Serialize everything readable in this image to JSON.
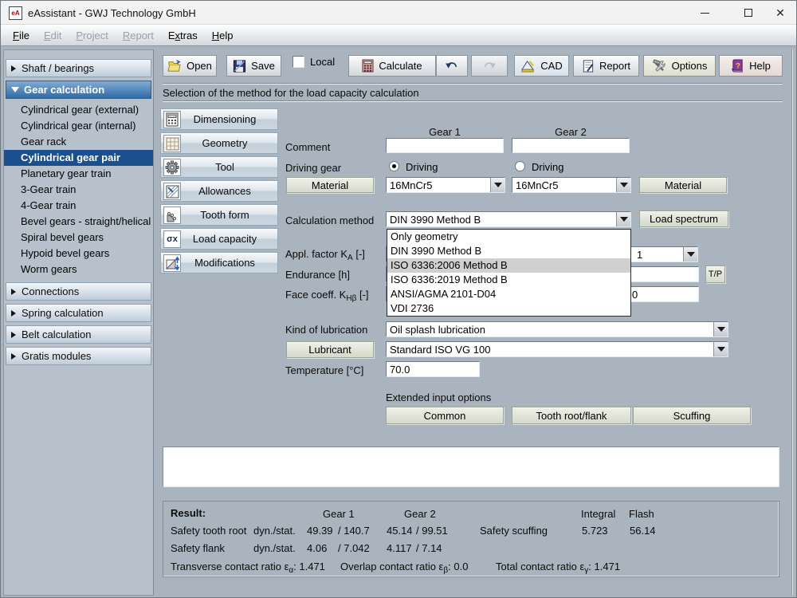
{
  "window": {
    "title": "eAssistant - GWJ Technology GmbH",
    "icon": "eA"
  },
  "menu": {
    "items": [
      {
        "pre": "",
        "key": "F",
        "post": "ile",
        "enabled": true
      },
      {
        "pre": "",
        "key": "E",
        "post": "dit",
        "enabled": false
      },
      {
        "pre": "",
        "key": "P",
        "post": "roject",
        "enabled": false
      },
      {
        "pre": "",
        "key": "R",
        "post": "eport",
        "enabled": false
      },
      {
        "pre": "E",
        "key": "x",
        "post": "tras",
        "enabled": true
      },
      {
        "pre": "",
        "key": "H",
        "post": "elp",
        "enabled": true
      }
    ]
  },
  "toolbar": {
    "open": "Open",
    "save": "Save",
    "local": "Local",
    "local_checked": false,
    "calculate": "Calculate",
    "cad": "CAD",
    "report": "Report",
    "options": "Options",
    "help": "Help"
  },
  "sidebar": {
    "sections": [
      {
        "label": "Shaft / bearings",
        "expanded": false
      },
      {
        "label": "Gear calculation",
        "expanded": true
      },
      {
        "label": "Connections",
        "expanded": false
      },
      {
        "label": "Spring calculation",
        "expanded": false
      },
      {
        "label": "Belt calculation",
        "expanded": false
      },
      {
        "label": "Gratis modules",
        "expanded": false
      }
    ],
    "gear_items": [
      "Cylindrical gear (external)",
      "Cylindrical gear (internal)",
      "Gear rack",
      "Cylindrical gear pair",
      "Planetary gear train",
      "3-Gear train",
      "4-Gear train",
      "Bevel gears - straight/helical",
      "Spiral bevel gears",
      "Hypoid bevel gears",
      "Worm gears"
    ],
    "selected": "Cylindrical gear pair"
  },
  "content": {
    "heading": "Selection of the method for the load capacity calculation",
    "nav_buttons": [
      {
        "label": "Dimensioning"
      },
      {
        "label": "Geometry"
      },
      {
        "label": "Tool"
      },
      {
        "label": "Allowances"
      },
      {
        "label": "Tooth form"
      },
      {
        "label": "Load capacity"
      },
      {
        "label": "Modifications"
      }
    ],
    "sigma_glyph": "σx",
    "form": {
      "gear1_header": "Gear 1",
      "gear2_header": "Gear 2",
      "comment_label": "Comment",
      "comment_gear1": "",
      "comment_gear2": "",
      "driving_label": "Driving gear",
      "driving_gear1": "Driving",
      "driving_gear2": "Driving",
      "driving_gear1_selected": true,
      "driving_gear2_selected": false,
      "material_button": "Material",
      "material_gear1": "16MnCr5",
      "material_gear2": "16MnCr5",
      "calc_method_label": "Calculation method",
      "calc_method_value": "DIN 3990 Method B",
      "load_spectrum_button": "Load spectrum",
      "appl_factor": {
        "pre": "Appl. factor K",
        "sub": "A",
        "post": " [-]"
      },
      "appl_factor_visible": "1",
      "endurance_label": "Endurance [h]",
      "endurance_value": "",
      "tp_button": {
        "sup": "T",
        "slash": "/",
        "sub": "P"
      },
      "face_coeff": {
        "pre": "Face coeff. K",
        "sub": "Hβ",
        "post": " [-]"
      },
      "face_coeff_visible": "0",
      "lubrication_label": "Kind of lubrication",
      "lubrication_value": "Oil splash lubrication",
      "lubricant_button": "Lubricant",
      "lubricant_value": "Standard ISO VG 100",
      "temperature_label": "Temperature [°C]",
      "temperature_value": "70.0"
    },
    "dropdown": {
      "items": [
        "Only geometry",
        "DIN 3990 Method B",
        "ISO 6336:2006 Method B",
        "ISO 6336:2019 Method B",
        "ANSI/AGMA 2101-D04",
        "VDI 2736"
      ],
      "highlighted": "ISO 6336:2006 Method B",
      "highlighted_index": 2
    },
    "extended": {
      "label": "Extended input options",
      "buttons": [
        "Common",
        "Tooth root/flank",
        "Scuffing"
      ]
    },
    "result": {
      "title": "Result:",
      "columns": {
        "gear1": "Gear 1",
        "gear2": "Gear 2",
        "integral": "Integral",
        "flash": "Flash"
      },
      "tooth_root": {
        "label": "Safety tooth root",
        "mode": "dyn./stat.",
        "g1_dyn": "49.39",
        "g1_stat": "/ 140.7",
        "g2_dyn": "45.14",
        "g2_stat": "/ 99.51"
      },
      "flank": {
        "label": "Safety flank",
        "mode": "dyn./stat.",
        "g1_dyn": "4.06",
        "g1_stat": "/ 7.042",
        "g2_dyn": "4.117",
        "g2_stat": "/ 7.14"
      },
      "scuffing": {
        "label": "Safety scuffing",
        "integral": "5.723",
        "flash": "56.14"
      },
      "ratios": [
        {
          "pre": "Transverse contact ratio ε",
          "sub": "α",
          "value": ": 1.471"
        },
        {
          "pre": "Overlap contact ratio ε",
          "sub": "β",
          "value": ": 0.0"
        },
        {
          "pre": "Total contact ratio ε",
          "sub": "γ",
          "value": ": 1.471"
        }
      ]
    }
  },
  "colors": {
    "selection_blue": "#1b4f8e",
    "header_blue": "#2d6aa5",
    "panel_gray": "#aab4be"
  }
}
